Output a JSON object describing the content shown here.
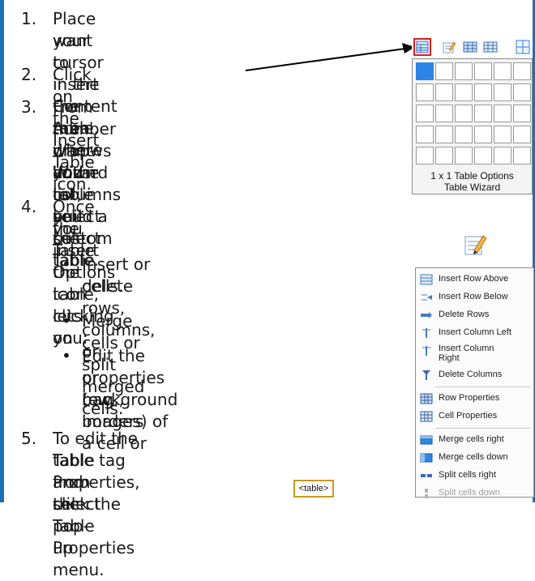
{
  "steps": [
    {
      "num": "1.",
      "lines": [
        "Place your cursor in the Content Area where you",
        "want to insert the table."
      ]
    },
    {
      "num": "2.",
      "lines": [
        "Click on the Insert Table icon."
      ]
    },
    {
      "num": "3.",
      "lines": [
        "From the drop-down list, select the",
        "number of rows and columns you",
        "want in the table or select Table",
        "Wizard to build a custom table."
      ]
    },
    {
      "num": "4.",
      "lines": [
        "Once you insert the table, clicking on",
        "the Table Options icon lets you:"
      ]
    },
    {
      "num": "5.",
      "lines": [
        "To edit the Table Properties, click the",
        "table tag and select Table Properties",
        "from the pop-up menu."
      ]
    }
  ],
  "bullets": [
    {
      "lines": [
        "Insert or delete rows, columns, or",
        "cells."
      ]
    },
    {
      "lines": [
        "Merge cells or split merged cells."
      ]
    },
    {
      "lines": [
        "Edit the properties (e.g., borders",
        "or background images) of a cell or",
        "row."
      ]
    }
  ],
  "bullet_char": "•",
  "insert_table_dropdown": {
    "size_label": "1 x 1 Table Options",
    "wizard_label": "Table Wizard",
    "selected_cell": "1 x 1"
  },
  "table_options_menu": {
    "items": [
      {
        "label": "Insert Row Above",
        "icon": "insert-row-above-icon",
        "disabled": false
      },
      {
        "label": "Insert Row Below",
        "icon": "insert-row-below-icon",
        "disabled": false
      },
      {
        "label": "Delete Rows",
        "icon": "delete-rows-icon",
        "disabled": false
      },
      {
        "label": "Insert Column Left",
        "icon": "insert-column-left-icon",
        "disabled": false
      },
      {
        "label": "Insert Column Right",
        "icon": "insert-column-right-icon",
        "disabled": false,
        "label_lines": [
          "Insert Column",
          "Right"
        ]
      },
      {
        "label": "Delete Columns",
        "icon": "delete-columns-icon",
        "disabled": false
      },
      {
        "label": "Row Properties",
        "icon": "row-properties-icon",
        "disabled": false
      },
      {
        "label": "Cell Properties",
        "icon": "cell-properties-icon",
        "disabled": false
      },
      {
        "label": "Merge cells right",
        "icon": "merge-cells-right-icon",
        "disabled": false
      },
      {
        "label": "Merge cells down",
        "icon": "merge-cells-down-icon",
        "disabled": false
      },
      {
        "label": "Split cells right",
        "icon": "split-cells-right-icon",
        "disabled": false
      },
      {
        "label": "Split cells down",
        "icon": "split-cells-down-icon",
        "disabled": true
      }
    ]
  },
  "table_tag": {
    "label": "<table>"
  },
  "colors": {
    "accent_bar": "#1f6fb8",
    "highlight_red": "#e01b1b",
    "selected_cell": "#2d84e6"
  }
}
